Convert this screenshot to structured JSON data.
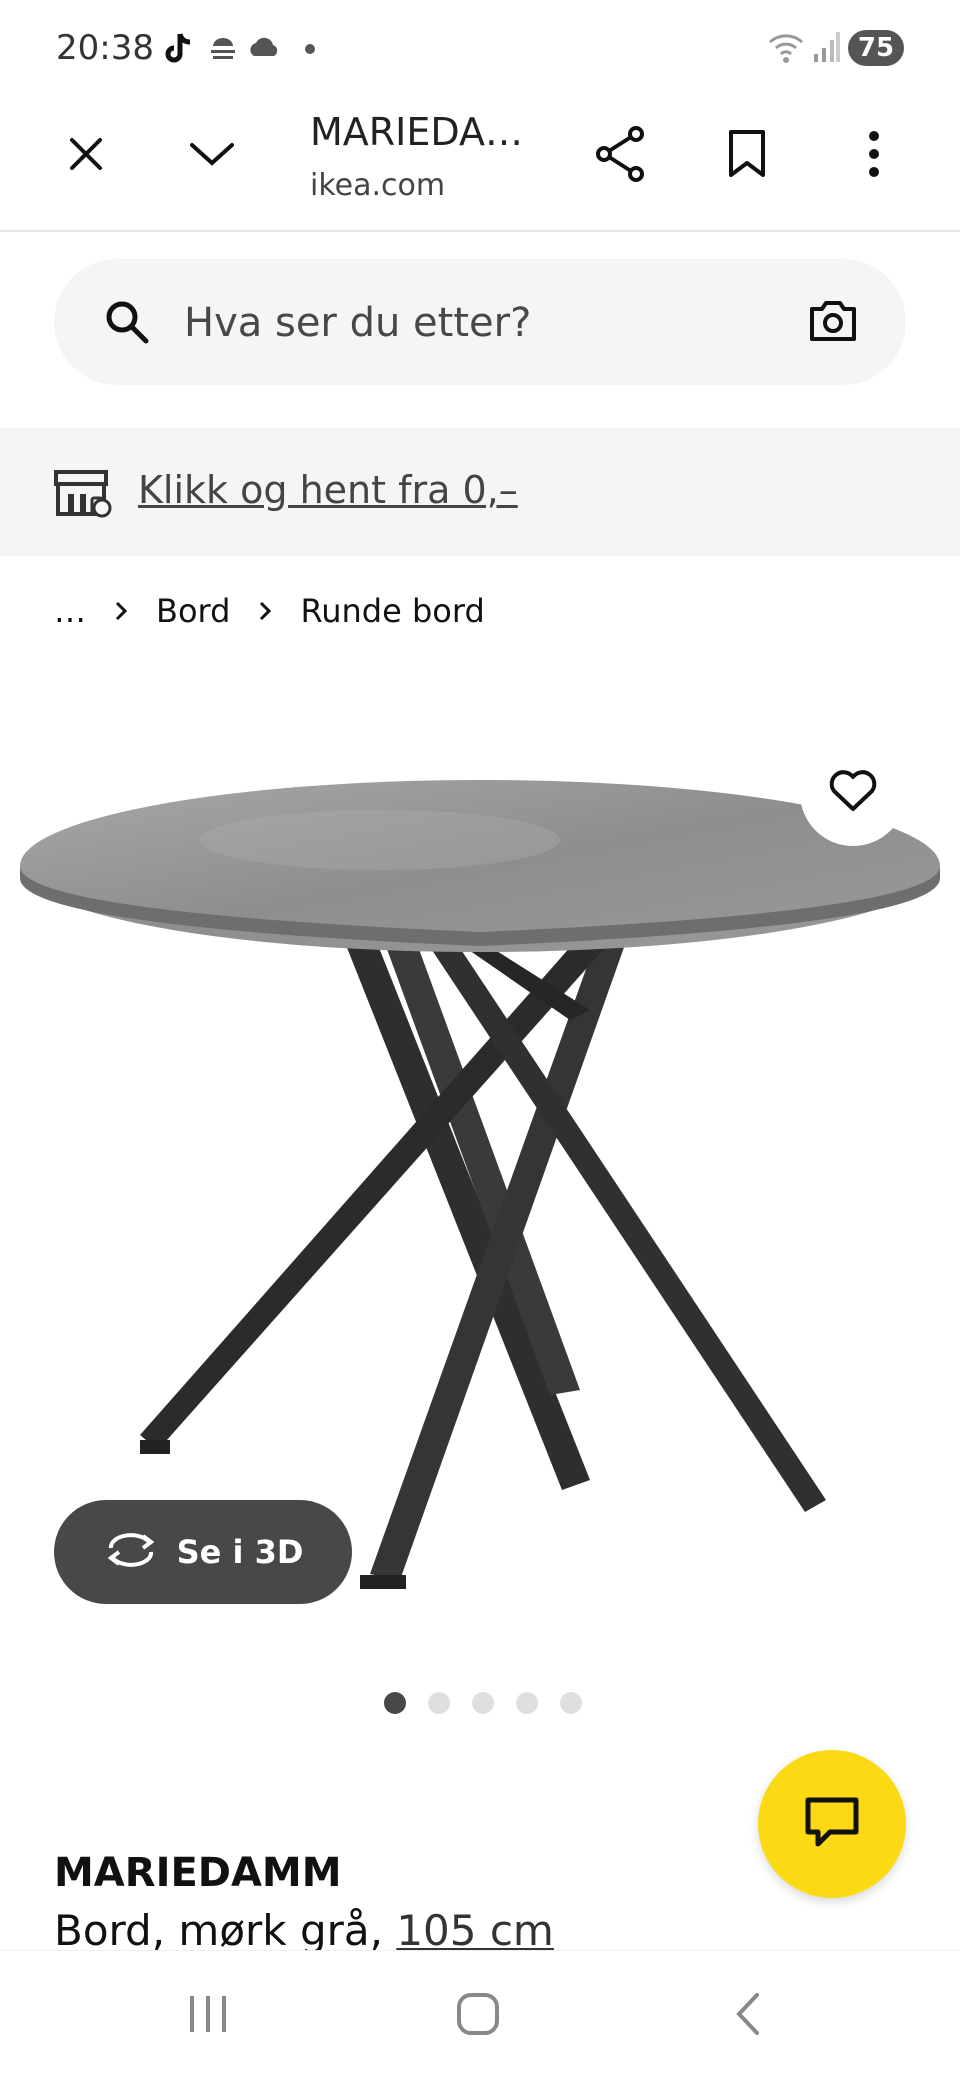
{
  "status_bar": {
    "time": "20:38",
    "battery": "75",
    "icons": [
      "tiktok-icon",
      "weather-icon",
      "cloud-icon",
      "dot-icon",
      "wifi-icon",
      "signal-icon",
      "battery-icon"
    ]
  },
  "toolbar": {
    "title": "MARIEDA…",
    "domain": "ikea.com",
    "icons": [
      "close-icon",
      "chevron-down-icon",
      "share-icon",
      "bookmark-icon",
      "more-vert-icon"
    ]
  },
  "search": {
    "placeholder": "Hva ser du etter?"
  },
  "banner": {
    "link_text": "Klikk og hent fra 0,–"
  },
  "breadcrumb": {
    "items": [
      "…",
      "Bord",
      "Runde bord"
    ]
  },
  "product": {
    "view3d_label": "Se i 3D",
    "name": "MARIEDAMM",
    "desc_prefix": "Bord, mørk grå, ",
    "size_link": "105 cm",
    "image_count": 5,
    "active_image": 1
  },
  "colors": {
    "accent_yellow": "#fbd914",
    "dark_button": "#484848",
    "surface_gray": "#f5f5f5"
  }
}
